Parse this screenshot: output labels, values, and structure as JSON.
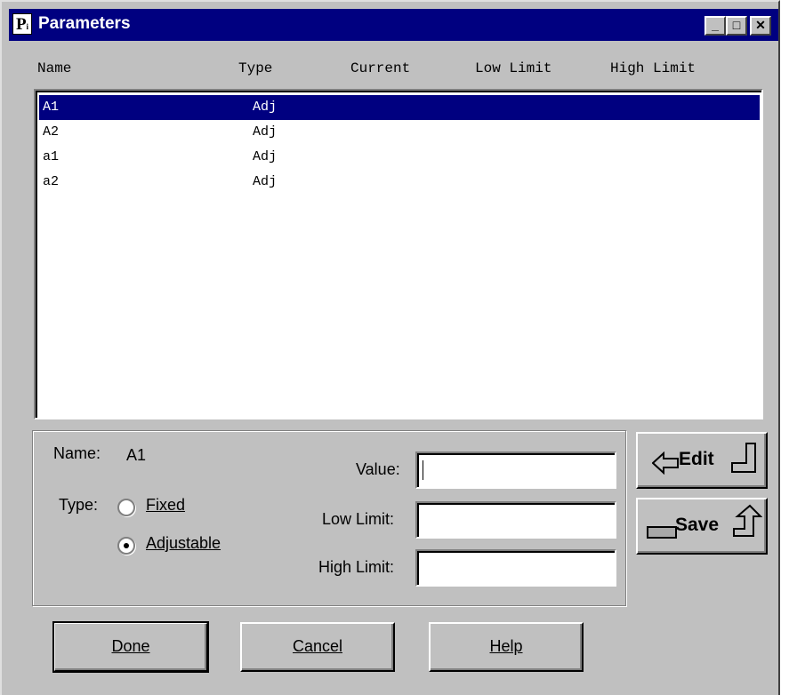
{
  "window": {
    "icon_letter": "P",
    "icon_sub": "i",
    "title": "Parameters",
    "minimize": "_",
    "maximize": "□",
    "close": "✕"
  },
  "columns": [
    "Name",
    "Type",
    "Current",
    "Low Limit",
    "High Limit"
  ],
  "rows": [
    {
      "name": "A1",
      "type": "Adj",
      "selected": true
    },
    {
      "name": "A2",
      "type": "Adj",
      "selected": false
    },
    {
      "name": "a1",
      "type": "Adj",
      "selected": false
    },
    {
      "name": "a2",
      "type": "Adj",
      "selected": false
    }
  ],
  "details": {
    "name_label": "Name:",
    "name_value": "A1",
    "type_label": "Type:",
    "fixed_label": "Fixed",
    "adjustable_label": "Adjustable",
    "selected_type": "Adjustable",
    "value_label": "Value:",
    "value": "",
    "low_label": "Low Limit:",
    "low_value": "",
    "high_label": "High Limit:",
    "high_value": ""
  },
  "side_buttons": {
    "edit_label": "Edit",
    "save_label": "Save"
  },
  "buttons": {
    "done": "Done",
    "cancel": "Cancel",
    "help": "Help"
  },
  "colors": {
    "titlebar": "#000080",
    "selection": "#000080",
    "face": "#c0c0c0"
  },
  "icons": [
    "app-icon",
    "minimize-icon",
    "maximize-icon",
    "close-icon",
    "edit-arrow-left-icon",
    "edit-return-arrow-icon",
    "save-bar-icon",
    "save-up-arrow-icon"
  ]
}
